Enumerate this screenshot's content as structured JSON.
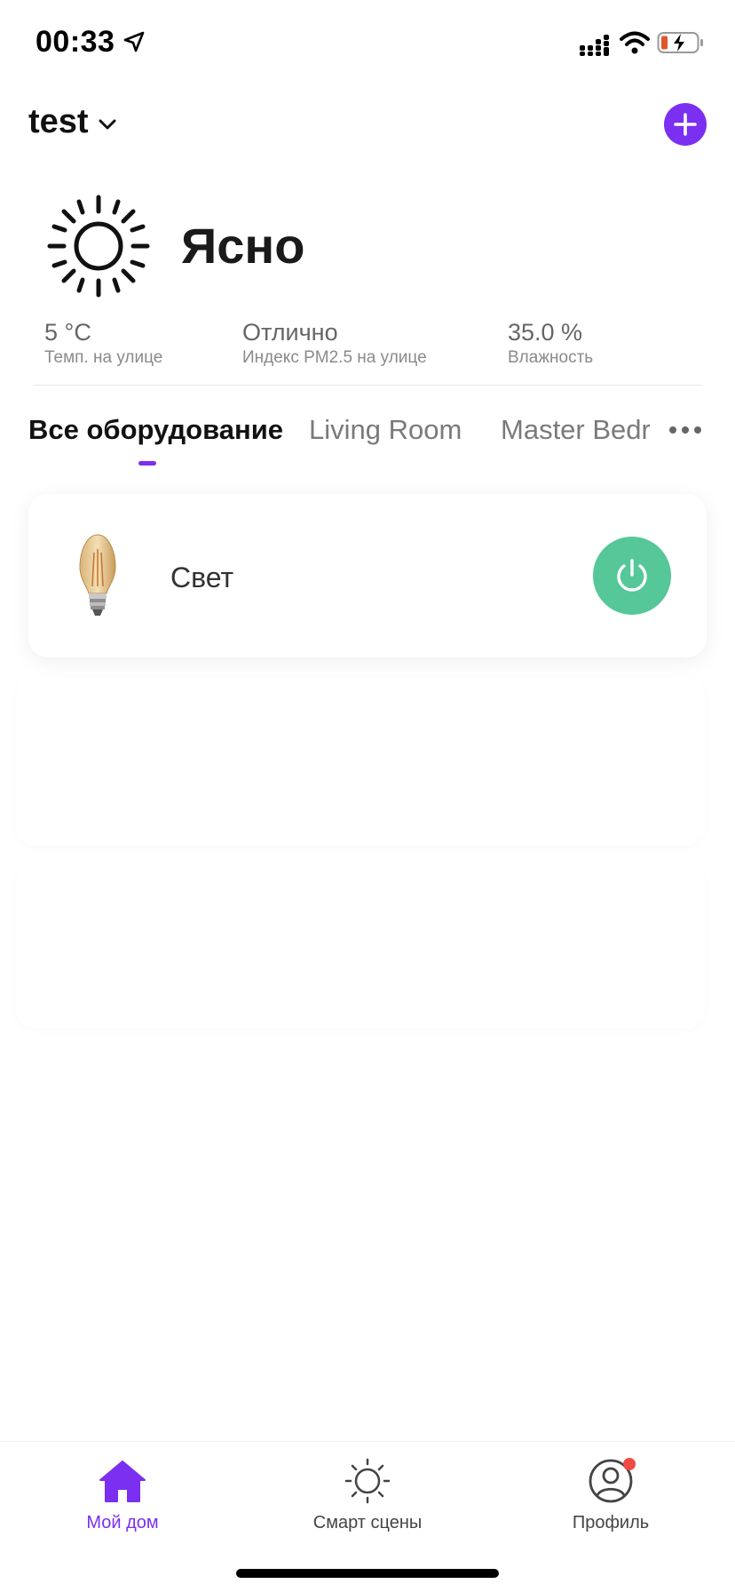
{
  "status_bar": {
    "time": "00:33",
    "icons": [
      "location-arrow-icon",
      "signal-icon",
      "wifi-icon",
      "battery-charging-icon"
    ]
  },
  "header": {
    "home_name": "test",
    "add_icon": "plus-icon",
    "accent_color": "#7b2ff0"
  },
  "weather": {
    "icon": "sun-icon",
    "condition": "Ясно",
    "stats": [
      {
        "value": "5 °C",
        "label": "Темп. на улице"
      },
      {
        "value": "Отлично",
        "label": "Индекс PM2.5 на улице"
      },
      {
        "value": "35.0 %",
        "label": "Влажность"
      }
    ]
  },
  "tabs": {
    "items": [
      {
        "label": "Все оборудование",
        "active": true
      },
      {
        "label": "Living Room",
        "active": false
      },
      {
        "label": "Master Bedr",
        "active": false
      }
    ],
    "more_icon": "more-dots-icon"
  },
  "devices": [
    {
      "name": "Свет",
      "icon": "light-bulb-image",
      "power_on": true,
      "power_color": "#55c799"
    }
  ],
  "bottom_nav": {
    "items": [
      {
        "label": "Мой дом",
        "icon": "home-icon",
        "active": true
      },
      {
        "label": "Смарт сцены",
        "icon": "sun-outline-icon",
        "active": false
      },
      {
        "label": "Профиль",
        "icon": "profile-icon",
        "active": false,
        "notification": true
      }
    ],
    "notification_color": "#ef4a43"
  }
}
